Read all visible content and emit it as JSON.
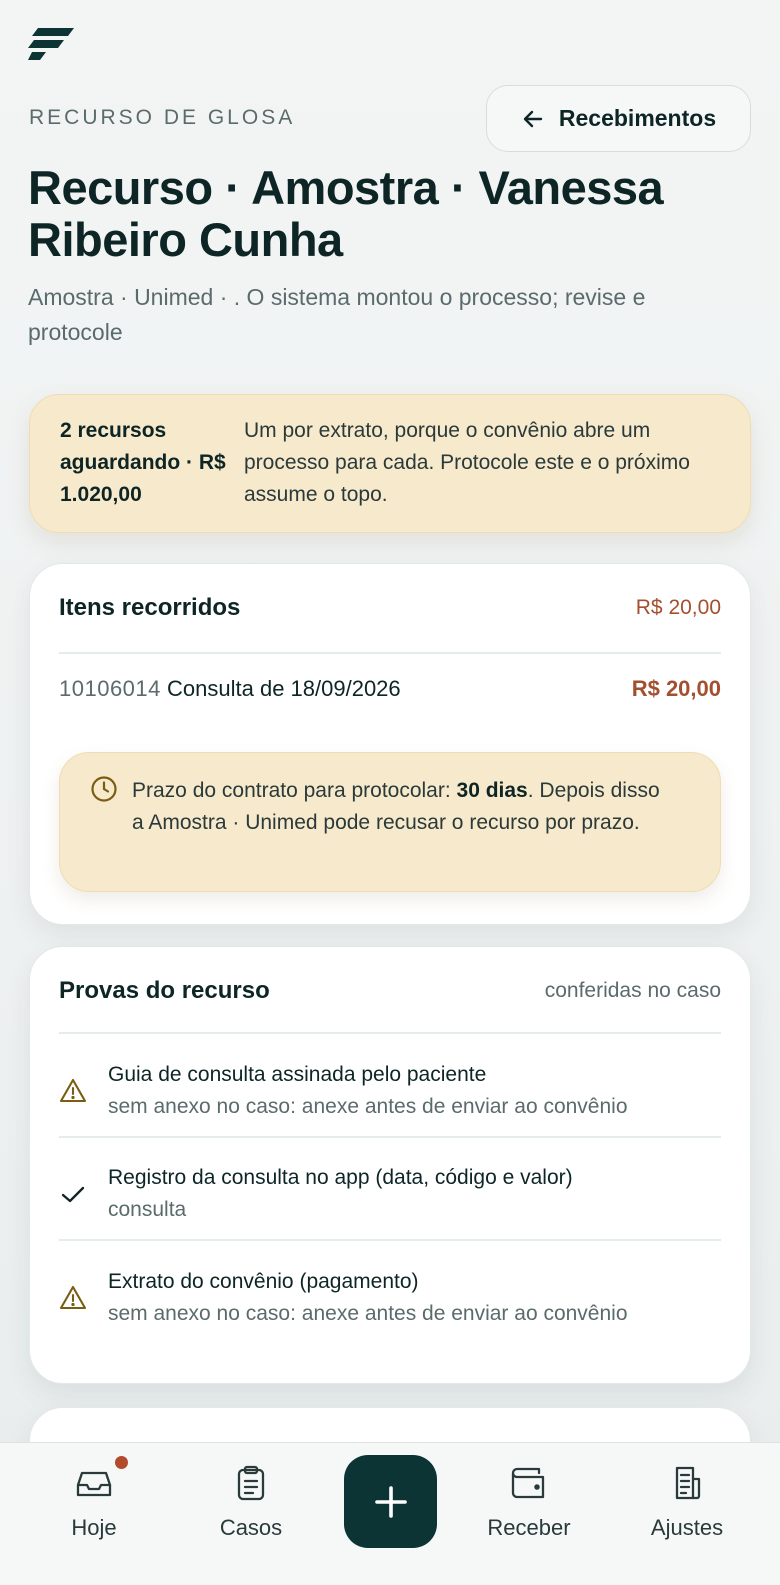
{
  "header": {
    "eyebrow": "RECURSO DE GLOSA",
    "back_button_label": "Recebimentos",
    "back_icon": "arrow-left-icon",
    "title": "Recurso · Amostra · Vanessa Ribeiro Cunha",
    "subtitle": "Amostra · Unimed · . O sistema montou o processo; revise e protocole"
  },
  "banner": {
    "strong": "2 recursos aguardando · R$ 1.020,00",
    "text": "Um por extrato, porque o convênio abre um processo para cada. Protocole este e o próximo assume o topo."
  },
  "items_card": {
    "title": "Itens recorridos",
    "total": "R$ 20,00",
    "items": [
      {
        "code": "10106014",
        "description": "Consulta de 18/09/2026",
        "value": "R$ 20,00"
      }
    ],
    "deadline": {
      "icon": "clock-icon",
      "prefix": "Prazo do contrato para protocolar: ",
      "days": "30 dias",
      "suffix": ". Depois disso a Amostra · Unimed pode recusar o recurso por prazo."
    }
  },
  "proofs_card": {
    "title": "Provas do recurso",
    "note": "conferidas no caso",
    "proofs": [
      {
        "icon": "warning-icon",
        "title": "Guia de consulta assinada pelo paciente",
        "subtitle": "sem anexo no caso: anexe antes de enviar ao convênio"
      },
      {
        "icon": "check-icon",
        "title": "Registro da consulta no app (data, código e valor)",
        "subtitle": "consulta"
      },
      {
        "icon": "warning-icon",
        "title": "Extrato do convênio (pagamento)",
        "subtitle": "sem anexo no caso: anexe antes de enviar ao convênio"
      }
    ]
  },
  "nav": {
    "items": [
      {
        "label": "Hoje",
        "icon": "inbox-icon",
        "has_badge": true
      },
      {
        "label": "Casos",
        "icon": "clipboard-icon"
      },
      {
        "label": "Receber",
        "icon": "wallet-icon"
      },
      {
        "label": "Ajustes",
        "icon": "receipt-icon"
      }
    ],
    "fab_icon": "plus-icon"
  },
  "colors": {
    "brand": "#0d3435",
    "accent_amount": "#a3502f",
    "warning_bg": "#f7e9cb",
    "warning_icon": "#7a5d12",
    "badge": "#b24b2b"
  }
}
